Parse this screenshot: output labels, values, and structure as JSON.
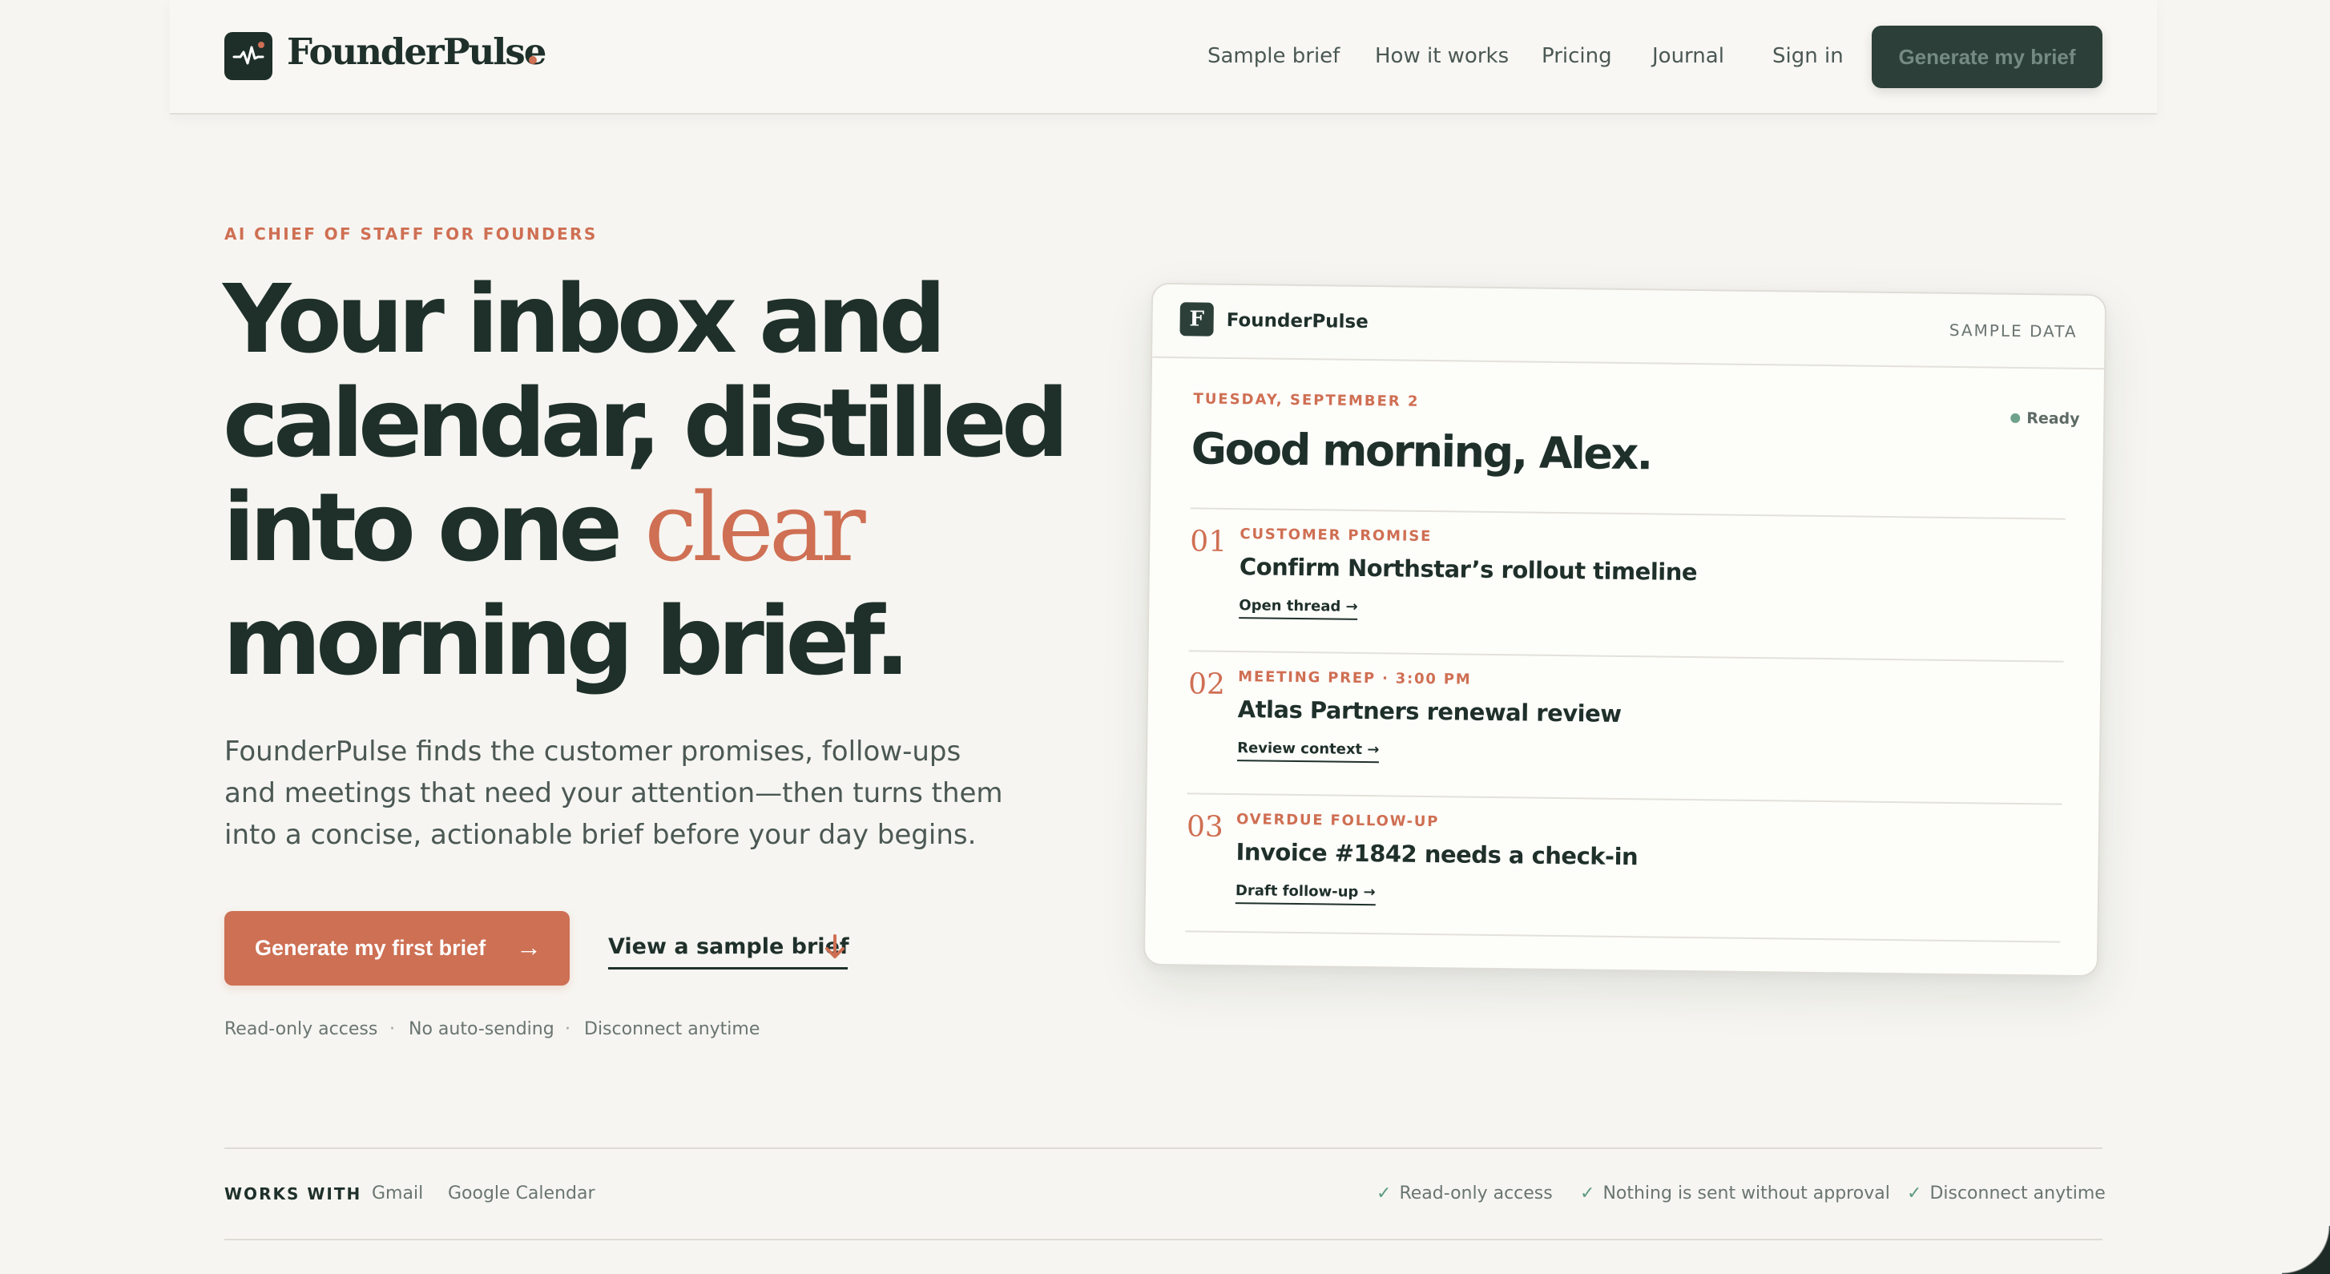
{
  "nav": {
    "brand": "FounderPulse",
    "links": [
      "Sample brief",
      "How it works",
      "Pricing",
      "Journal",
      "Sign in"
    ],
    "cta": "Generate my brief"
  },
  "hero": {
    "eyebrow": "AI CHIEF OF STAFF FOR FOUNDERS",
    "headline": {
      "line1": "Your inbox and",
      "line2": "calendar, distilled",
      "line3_before": "into one ",
      "line3_accent": "clear",
      "line4": "morning brief."
    },
    "subcopy": "FounderPulse finds the customer promises, follow-ups and meetings that need your attention—then turns them into a concise, actionable brief before your day begins.",
    "primary_cta": "Generate my first brief",
    "primary_cta_arrow": "→",
    "secondary_cta": "View a sample brief",
    "assurances": [
      "Read-only access",
      "No auto-sending",
      "Disconnect anytime"
    ],
    "separator": "·"
  },
  "card": {
    "brand": "FounderPulse",
    "logo_letter": "F",
    "tag": "SAMPLE DATA",
    "date": "TUESDAY, SEPTEMBER 2",
    "status": "Ready",
    "greeting": "Good morning, Alex.",
    "items": [
      {
        "num": "01",
        "category": "CUSTOMER PROMISE",
        "title": "Confirm Northstar’s rollout timeline",
        "action": "Open thread →"
      },
      {
        "num": "02",
        "category": "MEETING PREP · 3:00 PM",
        "title": "Atlas Partners renewal review",
        "action": "Review context →"
      },
      {
        "num": "03",
        "category": "OVERDUE FOLLOW-UP",
        "title": "Invoice #1842 needs a check-in",
        "action": "Draft follow-up →"
      }
    ]
  },
  "footer": {
    "works_with_label": "WORKS WITH",
    "integrations": [
      "Gmail",
      "Google Calendar"
    ],
    "check": "✓",
    "trust": [
      "Read-only access",
      "Nothing is sent without approval",
      "Disconnect anytime"
    ]
  },
  "colors": {
    "background": "#f6f5f1",
    "ink": "#1f302b",
    "accent": "#cf6f53",
    "dark_green": "#2c4039",
    "status_green": "#6fa28a"
  }
}
